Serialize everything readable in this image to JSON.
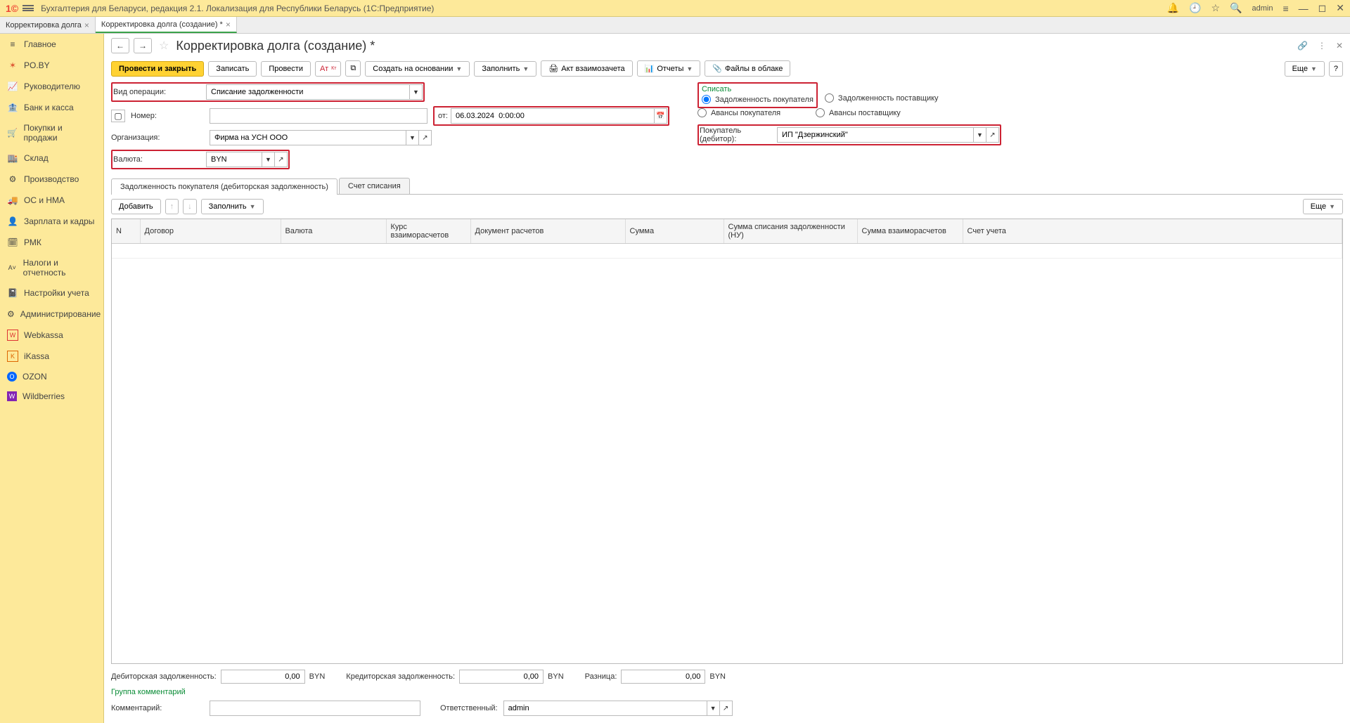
{
  "title": "Бухгалтерия для Беларуси, редакция 2.1. Локализация для Республики Беларусь  (1С:Предприятие)",
  "user": "admin",
  "tabs": [
    {
      "label": "Корректировка долга",
      "active": false
    },
    {
      "label": "Корректировка долга (создание) *",
      "active": true
    }
  ],
  "nav": [
    {
      "label": "Главное",
      "icon": "≡"
    },
    {
      "label": "PO.BY",
      "icon": "✶"
    },
    {
      "label": "Руководителю",
      "icon": "📈"
    },
    {
      "label": "Банк и касса",
      "icon": "🏦"
    },
    {
      "label": "Покупки и продажи",
      "icon": "🛒"
    },
    {
      "label": "Склад",
      "icon": "🏬"
    },
    {
      "label": "Производство",
      "icon": "⚙"
    },
    {
      "label": "ОС и НМА",
      "icon": "🚚"
    },
    {
      "label": "Зарплата и кадры",
      "icon": "👤"
    },
    {
      "label": "РМК",
      "icon": "🗓"
    },
    {
      "label": "Налоги и отчетность",
      "icon": "A˅"
    },
    {
      "label": "Настройки учета",
      "icon": "📓"
    },
    {
      "label": "Администрирование",
      "icon": "⚙"
    },
    {
      "label": "Webkassa",
      "icon": "W"
    },
    {
      "label": "iKassa",
      "icon": "K"
    },
    {
      "label": "OZON",
      "icon": "O"
    },
    {
      "label": "Wildberries",
      "icon": "W"
    }
  ],
  "page_title": "Корректировка долга (создание) *",
  "toolbar": {
    "post_close": "Провести и закрыть",
    "write": "Записать",
    "post": "Провести",
    "create_based": "Создать на основании",
    "fill": "Заполнить",
    "act": "Акт взаимозачета",
    "reports": "Отчеты",
    "files": "Файлы в облаке",
    "more": "Еще"
  },
  "form": {
    "op_label": "Вид операции:",
    "op_value": "Списание задолженности",
    "num_label": "Номер:",
    "num_value": "",
    "date_label": "от:",
    "date_value": "06.03.2024  0:00:00",
    "org_label": "Организация:",
    "org_value": "Фирма на УСН ООО",
    "cur_label": "Валюта:",
    "cur_value": "BYN",
    "writeoff_title": "Списать",
    "radios": {
      "debt_buyer": "Задолженность покупателя",
      "debt_supplier": "Задолженность поставщику",
      "adv_buyer": "Авансы покупателя",
      "adv_supplier": "Авансы поставщику"
    },
    "buyer_label": "Покупатель (дебитор):",
    "buyer_value": "ИП \"Дзержинский\""
  },
  "inner_tabs": {
    "t1": "Задолженность покупателя (дебиторская задолженность)",
    "t2": "Счет списания"
  },
  "tbl_toolbar": {
    "add": "Добавить",
    "fill": "Заполнить",
    "more": "Еще"
  },
  "columns": [
    "N",
    "Договор",
    "Валюта",
    "Курс взаиморасчетов",
    "Документ расчетов",
    "Сумма",
    "Сумма списания задолженности (НУ)",
    "Сумма взаиморасчетов",
    "Счет учета"
  ],
  "totals": {
    "debit_label": "Дебиторская задолженность:",
    "debit_value": "0,00",
    "debit_cur": "BYN",
    "credit_label": "Кредиторская задолженность:",
    "credit_value": "0,00",
    "credit_cur": "BYN",
    "diff_label": "Разница:",
    "diff_value": "0,00",
    "diff_cur": "BYN"
  },
  "comment_group": "Группа комментарий",
  "comment_label": "Комментарий:",
  "comment_value": "",
  "resp_label": "Ответственный:",
  "resp_value": "admin"
}
